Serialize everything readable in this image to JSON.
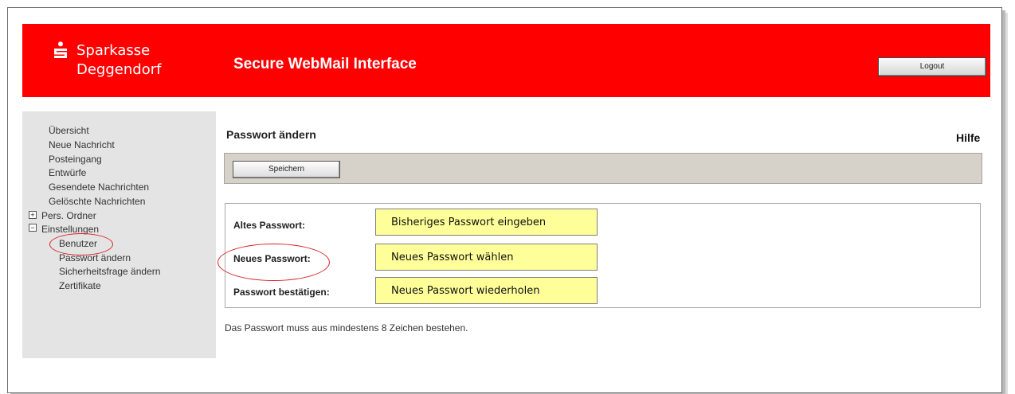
{
  "header": {
    "brand_line1": "Sparkasse",
    "brand_line2": "Deggendorf",
    "app_title": "Secure WebMail Interface",
    "logout_label": "Logout",
    "logo_icon": "sparkasse-s-icon",
    "background_color": "#ff0000"
  },
  "sidebar": {
    "items": [
      {
        "label": "Übersicht"
      },
      {
        "label": "Neue Nachricht"
      },
      {
        "label": "Posteingang"
      },
      {
        "label": "Entwürfe"
      },
      {
        "label": "Gesendete Nachrichten"
      },
      {
        "label": "Gelöschte Nachrichten"
      }
    ],
    "folders": [
      {
        "label": "Pers. Ordner",
        "toggle": "⊞"
      },
      {
        "label": "Einstellungen",
        "toggle": "⊟"
      }
    ],
    "settings_items": [
      {
        "label": "Benutzer"
      },
      {
        "label": "Passwort ändern"
      },
      {
        "label": "Sicherheitsfrage ändern"
      },
      {
        "label": "Zertifikate"
      }
    ]
  },
  "main": {
    "title": "Passwort ändern",
    "help_label": "Hilfe",
    "save_label": "Speichern",
    "fields": [
      {
        "label": "Altes Passwort:",
        "value": "Bisheriges Passwort eingeben"
      },
      {
        "label": "Neues Passwort:",
        "value": "Neues Passwort wählen"
      },
      {
        "label": "Passwort bestätigen:",
        "value": "Neues Passwort wiederholen"
      }
    ],
    "hint": "Das Passwort muss aus mindestens 8 Zeichen bestehen."
  },
  "colors": {
    "brand_red": "#ff0000",
    "sidebar_bg": "#e4e4e4",
    "input_highlight": "#ffff99",
    "annotation_red": "#d8232a"
  }
}
